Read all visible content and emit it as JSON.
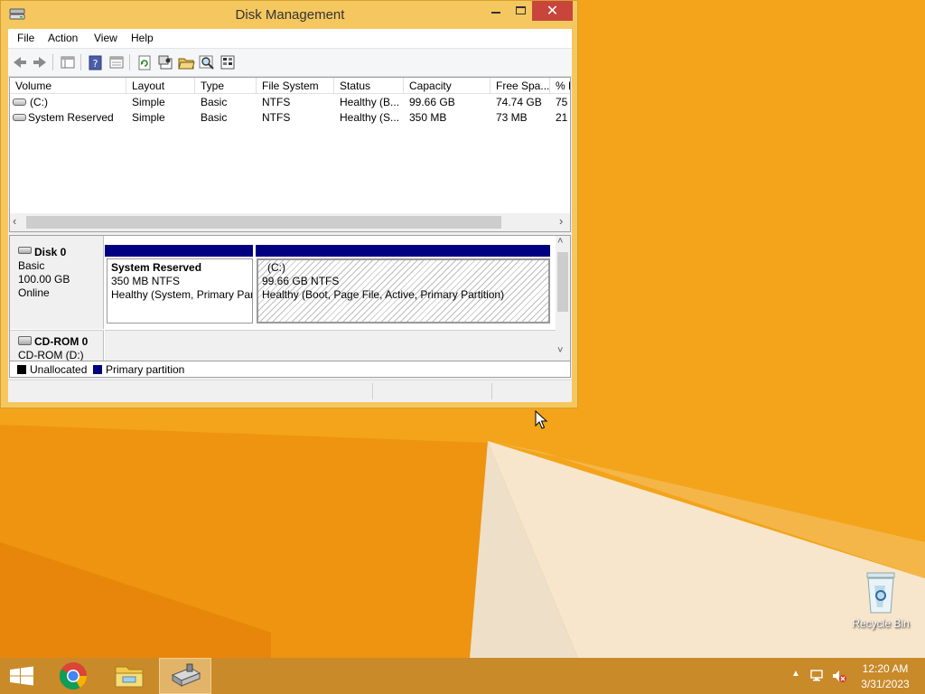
{
  "window": {
    "title": "Disk Management",
    "close_glyph": "✕"
  },
  "menu": {
    "items": [
      "File",
      "Action",
      "View",
      "Help"
    ]
  },
  "toolbar": {
    "buttons": [
      "back-icon",
      "forward-icon",
      "console-tree-icon",
      "help-icon",
      "properties-icon",
      "refresh-icon",
      "settings-icon",
      "open-folder-icon",
      "search-icon",
      "export-icon"
    ]
  },
  "volume_list": {
    "columns": [
      "Volume",
      "Layout",
      "Type",
      "File System",
      "Status",
      "Capacity",
      "Free Spa...",
      "% F"
    ],
    "rows": [
      [
        "(C:)",
        "Simple",
        "Basic",
        "NTFS",
        "Healthy (B...",
        "99.66 GB",
        "74.74 GB",
        "75"
      ],
      [
        "System Reserved",
        "Simple",
        "Basic",
        "NTFS",
        "Healthy (S...",
        "350 MB",
        "73 MB",
        "21"
      ]
    ],
    "scroll_left": "‹",
    "scroll_right": "›"
  },
  "disks": {
    "disk0": {
      "name": "Disk 0",
      "type": "Basic",
      "size": "100.00 GB",
      "state": "Online",
      "partitions": [
        {
          "name": "System Reserved",
          "size_fs": "350 MB NTFS",
          "status": "Healthy (System, Primary Par"
        },
        {
          "name": "(C:)",
          "size_fs": "99.66 GB NTFS",
          "status": "Healthy (Boot, Page File, Active, Primary Partition)"
        }
      ]
    },
    "cdrom0": {
      "name": "CD-ROM 0",
      "drive": "CD-ROM (D:)"
    },
    "scroll_up": "˄",
    "scroll_down": "˅"
  },
  "legend": {
    "unallocated": "Unallocated",
    "primary": "Primary partition",
    "unallocated_color": "#000000",
    "primary_color": "#000080"
  },
  "desktop": {
    "recycle_bin": "Recycle Bin"
  },
  "taskbar": {
    "apps": [
      "start-icon",
      "chrome-icon",
      "file-explorer-icon",
      "disk-management-icon"
    ],
    "tray_chevron": "▲",
    "time": "12:20 AM",
    "date": "3/31/2023"
  },
  "colors": {
    "desktop_bg": "#f3a41b",
    "window_frame": "#f5c75f",
    "close_button": "#c7453b",
    "partition_header": "#000080"
  }
}
